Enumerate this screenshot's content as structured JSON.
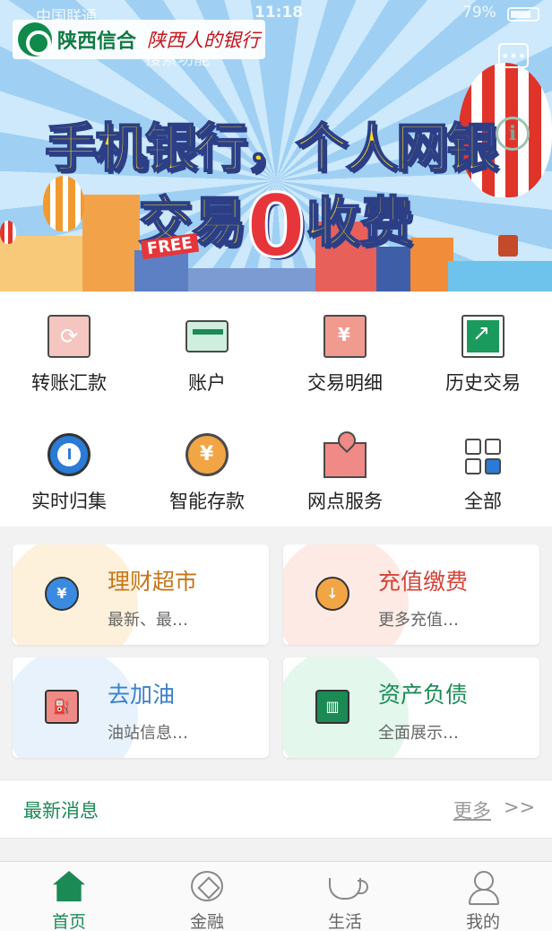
{
  "status_bar": {
    "carrier": "中国联通",
    "time": "11:18",
    "battery": "79%"
  },
  "header": {
    "logo_text": "陕西信合",
    "slogan": "陕西人的银行",
    "search_hint": "搜索功能"
  },
  "banner": {
    "headline_line1": "手机银行，个人网银",
    "headline_line2_prefix": "交易",
    "headline_zero": "0",
    "headline_line2_suffix": "收费",
    "free_tag": "FREE",
    "info_icon": "i"
  },
  "quick_menu": [
    {
      "label": "转账汇款",
      "icon": "transfer-icon"
    },
    {
      "label": "账户",
      "icon": "account-card-icon"
    },
    {
      "label": "交易明细",
      "icon": "receipt-icon"
    },
    {
      "label": "历史交易",
      "icon": "chart-icon"
    },
    {
      "label": "实时归集",
      "icon": "clock-icon"
    },
    {
      "label": "智能存款",
      "icon": "coin-icon"
    },
    {
      "label": "网点服务",
      "icon": "map-pin-icon"
    },
    {
      "label": "全部",
      "icon": "grid-icon"
    }
  ],
  "cards": [
    {
      "title": "理财超市",
      "subtitle": "最新、最…",
      "icon": "yen-coin-icon",
      "glyph": "¥"
    },
    {
      "title": "充值缴费",
      "subtitle": "更多充值…",
      "icon": "recharge-icon",
      "glyph": "↓"
    },
    {
      "title": "去加油",
      "subtitle": "油站信息…",
      "icon": "gas-pump-icon",
      "glyph": "⛽"
    },
    {
      "title": "资产负债",
      "subtitle": "全面展示…",
      "icon": "ledger-icon",
      "glyph": "▥"
    }
  ],
  "news": {
    "title": "最新消息",
    "more_label": "更多",
    "more_arrows": ">>"
  },
  "tabs": [
    {
      "label": "首页",
      "icon": "home-icon",
      "active": true
    },
    {
      "label": "金融",
      "icon": "finance-icon",
      "active": false
    },
    {
      "label": "生活",
      "icon": "coffee-cup-icon",
      "active": false
    },
    {
      "label": "我的",
      "icon": "user-icon",
      "active": false
    }
  ],
  "colors": {
    "brand_green": "#1b8a55",
    "banner_sky": "#9fd0f4",
    "headline_yellow": "#ffe11b",
    "accent_red": "#e6363b"
  }
}
